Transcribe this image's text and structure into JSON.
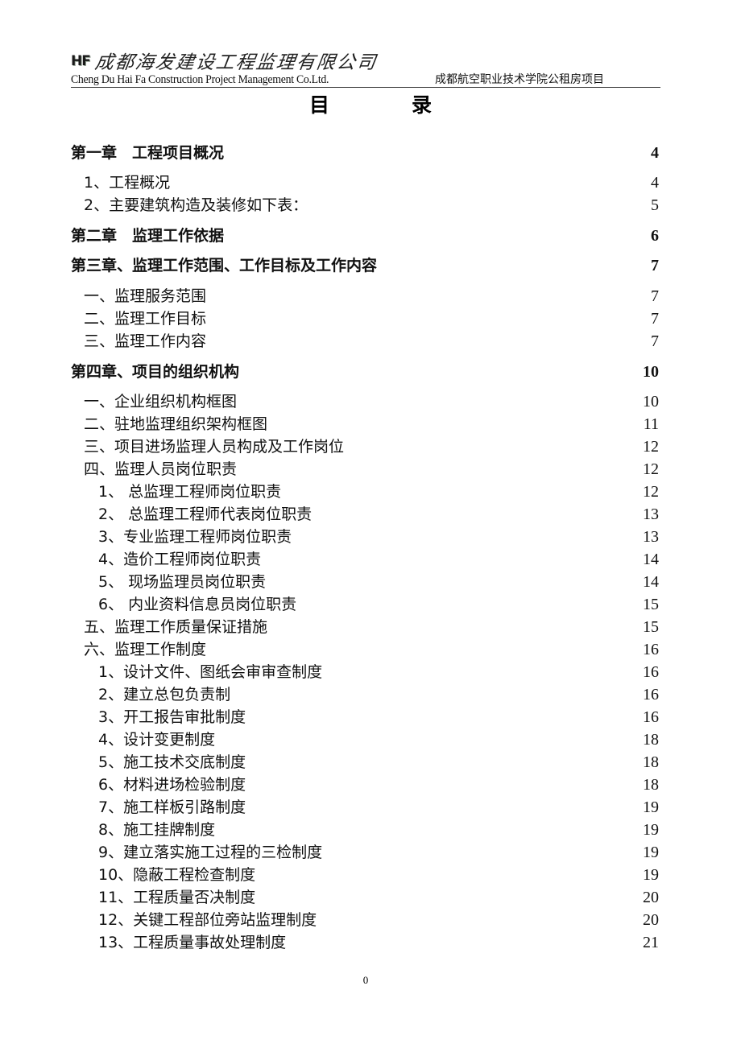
{
  "header": {
    "logo_text": "HF",
    "company_cn": "成都海发建设工程监理有限公司",
    "company_en": "Cheng Du Hai Fa Construction Project Management Co.Ltd.",
    "project_name": "成都航空职业技术学院公租房项目"
  },
  "title": {
    "left": "目",
    "right": "录"
  },
  "toc": [
    {
      "level": 1,
      "label": "第一章　工程项目概况",
      "page": "4"
    },
    {
      "level": 2,
      "label": "1、工程概况",
      "page": "4"
    },
    {
      "level": 2,
      "label": "2、主要建筑构造及装修如下表：",
      "page": "5"
    },
    {
      "level": 1,
      "label": "第二章　监理工作依据",
      "page": "6"
    },
    {
      "level": 1,
      "label": "第三章、监理工作范围、工作目标及工作内容",
      "page": "7"
    },
    {
      "level": 2,
      "label": "一、监理服务范围",
      "page": "7"
    },
    {
      "level": 2,
      "label": "二、监理工作目标",
      "page": "7"
    },
    {
      "level": 2,
      "label": "三、监理工作内容",
      "page": "7"
    },
    {
      "level": 1,
      "label": "第四章、项目的组织机构",
      "page": "10"
    },
    {
      "level": 2,
      "label": "一、企业组织机构框图",
      "page": "10"
    },
    {
      "level": 2,
      "label": "二、驻地监理组织架构框图",
      "page": "11"
    },
    {
      "level": 2,
      "label": "三、项目进场监理人员构成及工作岗位",
      "page": "12"
    },
    {
      "level": 2,
      "label": "四、监理人员岗位职责",
      "page": "12"
    },
    {
      "level": 3,
      "label": "1、 总监理工程师岗位职责",
      "page": "12"
    },
    {
      "level": 3,
      "label": "2、 总监理工程师代表岗位职责",
      "page": "13"
    },
    {
      "level": 3,
      "label": "3、专业监理工程师岗位职责",
      "page": "13"
    },
    {
      "level": 3,
      "label": "4、造价工程师岗位职责",
      "page": "14"
    },
    {
      "level": 3,
      "label": "5、 现场监理员岗位职责",
      "page": "14"
    },
    {
      "level": 3,
      "label": "6、 内业资料信息员岗位职责",
      "page": "15"
    },
    {
      "level": 2,
      "label": "五、监理工作质量保证措施",
      "page": "15"
    },
    {
      "level": 2,
      "label": "六、监理工作制度",
      "page": "16"
    },
    {
      "level": 3,
      "label": "1、设计文件、图纸会审审查制度",
      "page": "16"
    },
    {
      "level": 3,
      "label": "2、建立总包负责制",
      "page": "16"
    },
    {
      "level": 3,
      "label": "3、开工报告审批制度",
      "page": "16"
    },
    {
      "level": 3,
      "label": "4、设计变更制度",
      "page": "18"
    },
    {
      "level": 3,
      "label": "5、施工技术交底制度",
      "page": "18"
    },
    {
      "level": 3,
      "label": "6、材料进场检验制度",
      "page": "18"
    },
    {
      "level": 3,
      "label": "7、施工样板引路制度",
      "page": "19"
    },
    {
      "level": 3,
      "label": "8、施工挂牌制度",
      "page": "19"
    },
    {
      "level": 3,
      "label": "9、建立落实施工过程的三检制度",
      "page": "19"
    },
    {
      "level": 3,
      "label": "10、隐蔽工程检查制度",
      "page": "19"
    },
    {
      "level": 3,
      "label": "11、工程质量否决制度",
      "page": "20"
    },
    {
      "level": 3,
      "label": "12、关键工程部位旁站监理制度",
      "page": "20"
    },
    {
      "level": 3,
      "label": "13、工程质量事故处理制度",
      "page": "21"
    }
  ],
  "footer": {
    "page_number": "0"
  }
}
